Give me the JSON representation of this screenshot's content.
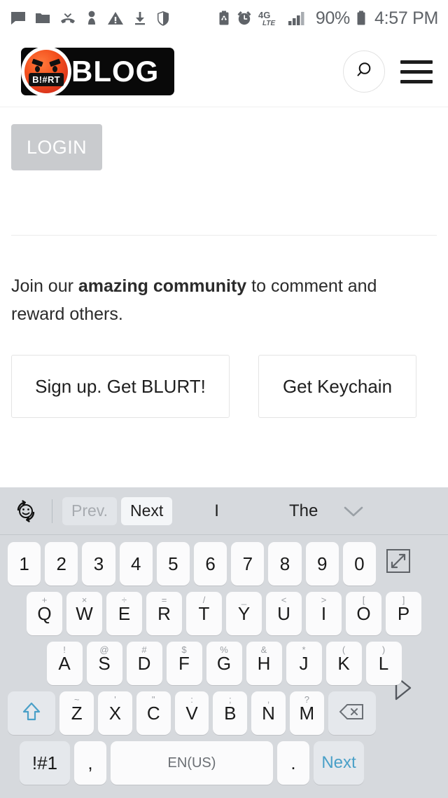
{
  "status_bar": {
    "left_icons": [
      "message-icon",
      "folder-icon",
      "missed-call-icon",
      "person-icon",
      "warning-icon",
      "download-icon",
      "shield-icon"
    ],
    "right_icons": [
      "battery-saver-icon",
      "alarm-icon",
      "network-4g-lte-icon",
      "signal-bars-icon",
      "battery-icon"
    ],
    "network": "4G",
    "network_sub": "LTE",
    "battery_percent": "90%",
    "time": "4:57 PM"
  },
  "header": {
    "logo_tag": "B!#RT",
    "logo_plate": "BLOG",
    "search_icon": "search-icon",
    "menu_icon": "hamburger-menu-icon"
  },
  "page": {
    "login_label": "LOGIN",
    "join_prefix": "Join our ",
    "join_bold": "amazing community",
    "join_suffix": " to comment and reward others.",
    "cta_primary": "Sign up. Get BLURT!",
    "cta_secondary": "Get Keychain"
  },
  "keyboard": {
    "toolbar": {
      "emoji_icon": "emoji-rotate-icon",
      "prev_label": "Prev.",
      "next_label": "Next",
      "suggestion_1": "I",
      "suggestion_2": "The",
      "chevron_icon": "chevron-down-icon"
    },
    "resize_icon": "expand-keyboard-icon",
    "cursor_icon": "cursor-right-icon",
    "rows": {
      "numbers": [
        {
          "main": "1"
        },
        {
          "main": "2"
        },
        {
          "main": "3"
        },
        {
          "main": "4"
        },
        {
          "main": "5"
        },
        {
          "main": "6"
        },
        {
          "main": "7"
        },
        {
          "main": "8"
        },
        {
          "main": "9"
        },
        {
          "main": "0"
        }
      ],
      "top": [
        {
          "main": "Q",
          "sup": "+"
        },
        {
          "main": "W",
          "sup": "×"
        },
        {
          "main": "E",
          "sup": "÷"
        },
        {
          "main": "R",
          "sup": "="
        },
        {
          "main": "T",
          "sup": "/"
        },
        {
          "main": "Y",
          "sup": "_"
        },
        {
          "main": "U",
          "sup": "<"
        },
        {
          "main": "I",
          "sup": ">"
        },
        {
          "main": "O",
          "sup": "["
        },
        {
          "main": "P",
          "sup": "]"
        }
      ],
      "home": [
        {
          "main": "A",
          "sup": "!"
        },
        {
          "main": "S",
          "sup": "@"
        },
        {
          "main": "D",
          "sup": "#"
        },
        {
          "main": "F",
          "sup": "$"
        },
        {
          "main": "G",
          "sup": "%"
        },
        {
          "main": "H",
          "sup": "&"
        },
        {
          "main": "J",
          "sup": "*"
        },
        {
          "main": "K",
          "sup": "("
        },
        {
          "main": "L",
          "sup": ")"
        }
      ],
      "bottom": [
        {
          "main": "Z",
          "sup": "~"
        },
        {
          "main": "X",
          "sup": "'"
        },
        {
          "main": "C",
          "sup": "\""
        },
        {
          "main": "V",
          "sup": ":"
        },
        {
          "main": "B",
          "sup": ";"
        },
        {
          "main": "N",
          "sup": ","
        },
        {
          "main": "M",
          "sup": "?"
        }
      ],
      "shift_icon": "shift-key-icon",
      "backspace_icon": "backspace-key-icon",
      "symbols_label": "!#1",
      "comma_label": ",",
      "space_label": "EN(US)",
      "period_label": ".",
      "enter_label": "Next"
    }
  },
  "colors": {
    "accent_teal": "#4aa0c8",
    "brand_red": "#f4511e",
    "keyboard_bg": "#d6d9dd",
    "key_bg": "#fbfbfc",
    "login_bg": "#c9cbce"
  }
}
